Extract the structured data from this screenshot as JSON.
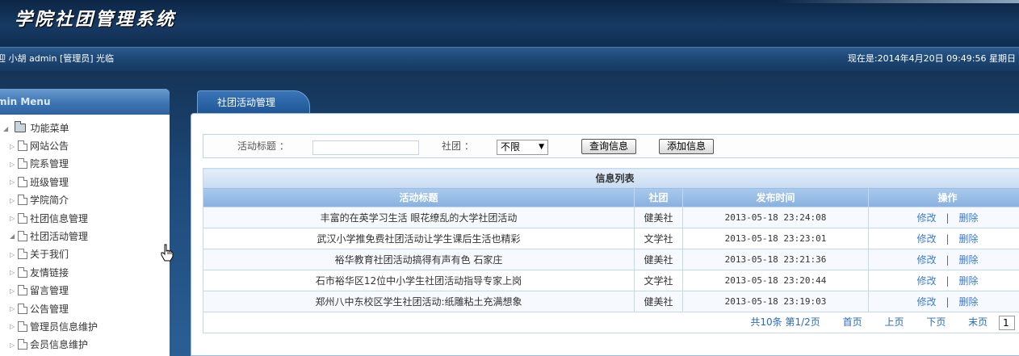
{
  "header": {
    "app_title": "学院社团管理系统"
  },
  "statusbar": {
    "welcome": "迎 小胡  admin [管理员] 光临",
    "datetime": "现在是:2014年4月20日 09:49:56 星期日"
  },
  "sidebar": {
    "header": "min Menu",
    "root": "功能菜单",
    "items": [
      {
        "label": "网站公告",
        "expanded": false
      },
      {
        "label": "院系管理",
        "expanded": false
      },
      {
        "label": "班级管理",
        "expanded": false
      },
      {
        "label": "学院简介",
        "expanded": false
      },
      {
        "label": "社团信息管理",
        "expanded": false
      },
      {
        "label": "社团活动管理",
        "expanded": true
      },
      {
        "label": "关于我们",
        "expanded": false
      },
      {
        "label": "友情链接",
        "expanded": false
      },
      {
        "label": "留言管理",
        "expanded": false
      },
      {
        "label": "公告管理",
        "expanded": false
      },
      {
        "label": "管理员信息维护",
        "expanded": false
      },
      {
        "label": "会员信息维护",
        "expanded": false
      }
    ]
  },
  "tab": {
    "label": "社团活动管理"
  },
  "search": {
    "title_label": "活动标题 ：",
    "title_value": "",
    "club_label": "社团 ：",
    "club_selected": "不限",
    "query_button": "查询信息",
    "add_button": "添加信息"
  },
  "table": {
    "caption": "信息列表",
    "columns": [
      "活动标题",
      "社团",
      "发布时间",
      "操作"
    ],
    "edit_label": "修改",
    "separator": "|",
    "delete_label": "删除",
    "rows": [
      {
        "title": "丰富的在英学习生活 眼花缭乱的大学社团活动",
        "club": "健美社",
        "time": "2013-05-18 23:24:08"
      },
      {
        "title": "武汉小学推免费社团活动让学生课后生活也精彩",
        "club": "文学社",
        "time": "2013-05-18 23:23:01"
      },
      {
        "title": "裕华教育社团活动搞得有声有色 石家庄",
        "club": "健美社",
        "time": "2013-05-18 23:21:36"
      },
      {
        "title": "石市裕华区12位中小学生社团活动指导专家上岗",
        "club": "文学社",
        "time": "2013-05-18 23:20:44"
      },
      {
        "title": "郑州八中东校区学生社团活动:纸雕粘土充满想象",
        "club": "健美社",
        "time": "2013-05-18 23:19:03"
      }
    ]
  },
  "pagination": {
    "total": "共10条  第1/2页",
    "first": "首页",
    "prev": "上页",
    "next": "下页",
    "last": "末页",
    "page_input": "1"
  }
}
